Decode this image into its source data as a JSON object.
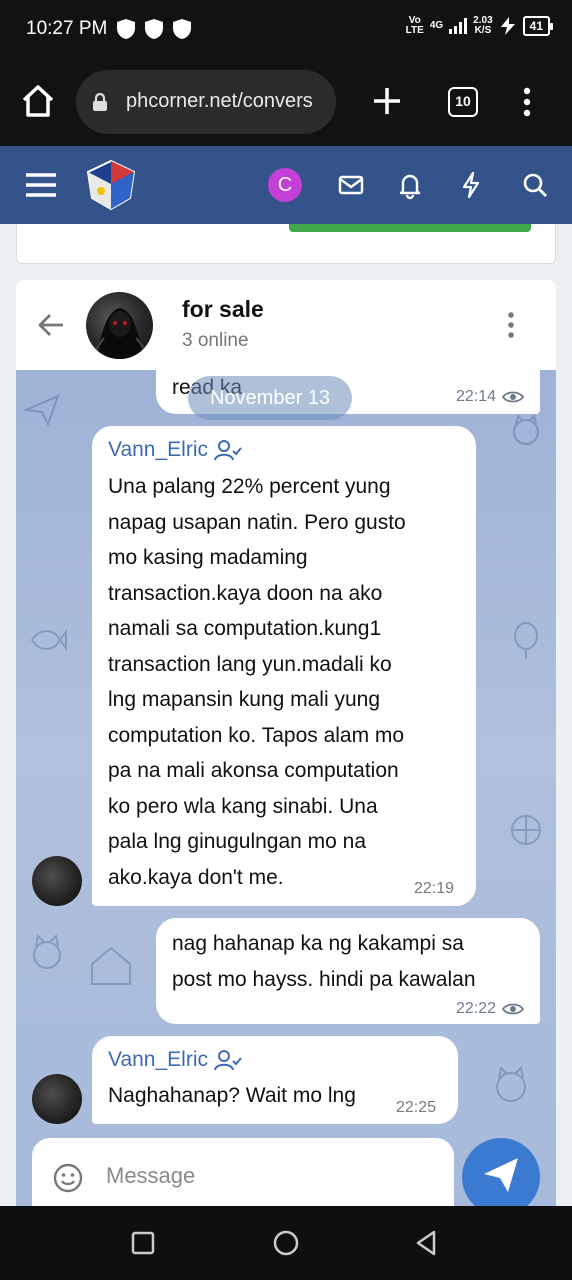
{
  "status_bar": {
    "time": "10:27 PM",
    "network_top": "Vo",
    "network_bottom": "LTE",
    "signal": "4G",
    "speed_top": "2.03",
    "speed_bottom": "K/S",
    "battery": "41"
  },
  "browser": {
    "url": "phcorner.net/convers",
    "tab_count": "10"
  },
  "site_header": {
    "user_initial": "C",
    "header_color": "#33538a"
  },
  "chat": {
    "title": "for sale",
    "subtitle": "3 online",
    "date_separator": "November 13"
  },
  "messages": [
    {
      "direction": "outgoing",
      "text": "read ka",
      "time": "22:14"
    },
    {
      "direction": "incoming",
      "sender": "Vann_Elric",
      "lines": [
        "Una palang 22% percent yung",
        "napag usapan natin. Pero gusto",
        "mo kasing madaming",
        "transaction.kaya doon na ako",
        "namali sa computation.kung1",
        "transaction lang yun.madali ko",
        "lng mapansin kung mali yung",
        "computation ko. Tapos alam mo",
        "pa na mali akonsa computation",
        "ko pero wla kang sinabi. Una",
        "pala lng ginugulngan mo na",
        "ako.kaya don't me."
      ],
      "time": "22:19"
    },
    {
      "direction": "outgoing",
      "lines": [
        "nag hahanap ka ng kakampi sa",
        "post mo hayss. hindi pa kawalan"
      ],
      "time": "22:22"
    },
    {
      "direction": "incoming",
      "sender": "Vann_Elric",
      "text": "Naghahanap? Wait mo lng",
      "time": "22:25"
    }
  ],
  "composer": {
    "placeholder": "Message"
  },
  "colors": {
    "accent": "#3a7bd1",
    "sender_name": "#3d6bb3",
    "green_button": "#3fa64a"
  }
}
